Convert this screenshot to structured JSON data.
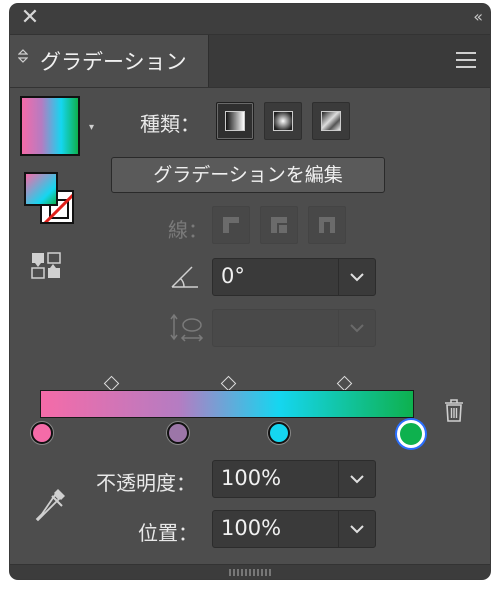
{
  "window": {
    "close_glyph": "✕",
    "collapse_glyph": "‹‹"
  },
  "tab": {
    "title": "グラデーション",
    "arrows_glyph": "◇"
  },
  "swatches": {
    "fill_gradient_colors": [
      "#f56ba8",
      "#b57cc2",
      "#15d6f0",
      "#0eb14e"
    ],
    "stroke": "none",
    "dropdown_glyph": "▾"
  },
  "type_row": {
    "label": "種類：",
    "options": [
      "linear",
      "radial",
      "freeform"
    ],
    "selected": "linear"
  },
  "edit_button": {
    "label": "グラデーションを編集"
  },
  "stroke_row": {
    "label": "線：",
    "enabled": false
  },
  "angle": {
    "value": "0°",
    "icon": "angle-icon"
  },
  "aspect": {
    "value": "",
    "icon": "aspect-ratio-icon",
    "enabled": false
  },
  "gradient_slider": {
    "stops": [
      {
        "color": "#f56ba8",
        "position": 0
      },
      {
        "color": "#9c76a8",
        "position": 37
      },
      {
        "color": "#15d6f0",
        "position": 64
      },
      {
        "color": "#0eb14e",
        "position": 100,
        "selected": true
      }
    ],
    "midpoints": [
      19,
      50,
      82
    ]
  },
  "opacity": {
    "label": "不透明度：",
    "value": "100%"
  },
  "location": {
    "label": "位置：",
    "value": "100%"
  },
  "colors": {
    "panel_bg": "#4d4d4d",
    "selection_ring": "#2a6fff"
  }
}
